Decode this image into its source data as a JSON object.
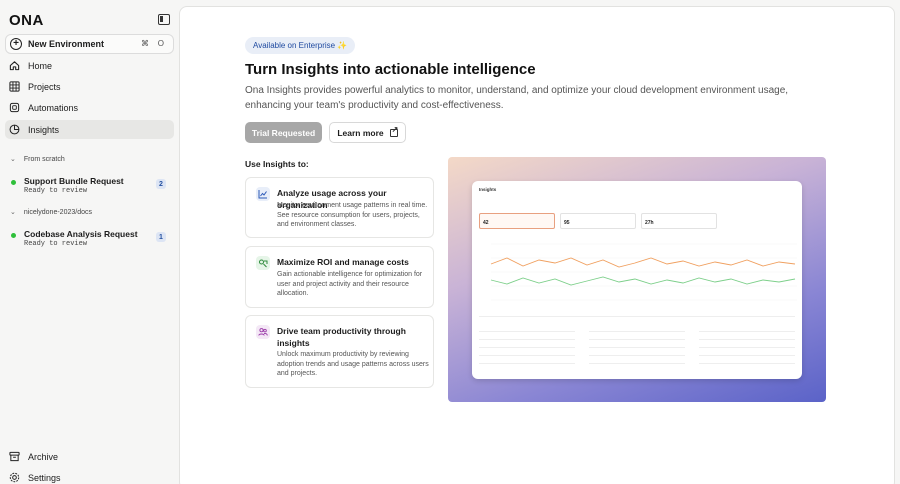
{
  "sidebar": {
    "logo": "ONA",
    "new_environment": {
      "label": "New Environment",
      "shortcut_cmd": "⌘",
      "shortcut_key": "O"
    },
    "nav": [
      {
        "label": "Home",
        "icon": "home-icon"
      },
      {
        "label": "Projects",
        "icon": "grid-icon"
      },
      {
        "label": "Automations",
        "icon": "automation-icon"
      },
      {
        "label": "Insights",
        "icon": "insights-icon",
        "active": true
      }
    ],
    "groups": [
      {
        "label": "From scratch",
        "tasks": [
          {
            "title": "Support Bundle Request",
            "status": "Ready to review",
            "count": "2"
          }
        ]
      },
      {
        "label": "nicelydone-2023/docs",
        "tasks": [
          {
            "title": "Codebase Analysis Request",
            "status": "Ready to review",
            "count": "1"
          }
        ]
      }
    ],
    "footer": [
      {
        "label": "Archive",
        "icon": "archive-icon"
      },
      {
        "label": "Settings",
        "icon": "settings-icon"
      }
    ]
  },
  "main": {
    "pill": "Available on Enterprise ✨",
    "headline": "Turn Insights into actionable intelligence",
    "description": "Ona Insights provides powerful analytics to monitor, understand, and optimize your cloud development environment usage, enhancing your team's productivity and cost-effectiveness.",
    "trial_button": "Trial Requested",
    "learn_button": "Learn more",
    "use_label": "Use Insights to:",
    "cards": [
      {
        "title": "Analyze usage across your organization",
        "body": "Monitor environment usage patterns in real time. See resource consumption for users, projects, and environment classes.",
        "icon": "chart-icon"
      },
      {
        "title": "Maximize ROI and manage costs",
        "body": "Gain actionable intelligence for optimization for user and project activity and their resource allocation.",
        "icon": "roi-icon"
      },
      {
        "title": "Drive team productivity through insights",
        "body": "Unlock maximum productivity by reviewing adoption trends and usage patterns across users and projects.",
        "icon": "team-icon"
      }
    ],
    "preview": {
      "title": "Insights",
      "stats": [
        {
          "value": "42"
        },
        {
          "value": "95"
        },
        {
          "value": "27h"
        }
      ]
    }
  },
  "colors": {
    "accent": "#1f4aa0",
    "status_ready": "#2fbf3a",
    "line_orange": "#f0a060",
    "line_green": "#7dcf8a"
  }
}
